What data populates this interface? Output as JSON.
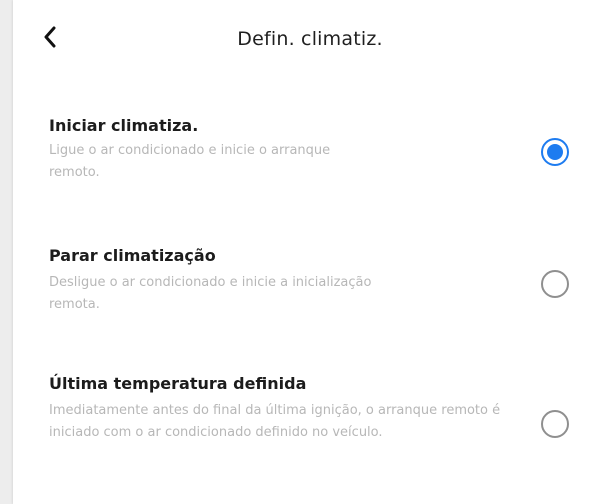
{
  "header": {
    "title": "Defin. climatiz."
  },
  "options": [
    {
      "title": "Iniciar climatiza.",
      "description": "Ligue o ar condicionado e inicie o arranque remoto.",
      "selected": true
    },
    {
      "title": "Parar climatização",
      "description": "Desligue o ar condicionado e inicie a inicialização remota.",
      "selected": false
    },
    {
      "title": "Última temperatura definida",
      "description": "Imediatamente antes do final da última ignição, o arranque remoto é iniciado com o ar condicionado definido no veículo.",
      "selected": false
    }
  ],
  "colors": {
    "accent": "#1e7cf0",
    "title_text": "#1c1c1c",
    "secondary_text": "#b7b7b7",
    "radio_border": "#8f8f8f"
  },
  "icons": {
    "back": "chevron-left-icon"
  }
}
